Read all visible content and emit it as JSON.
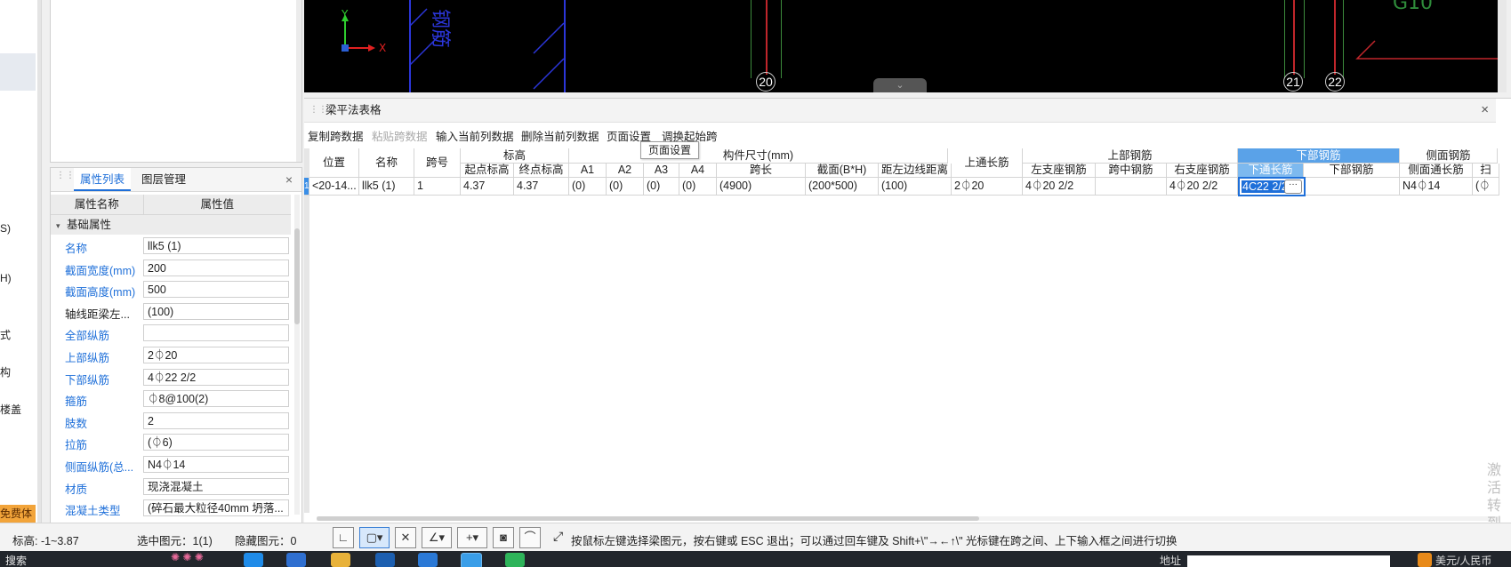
{
  "left_strip": {
    "labels": [
      {
        "text": "S)"
      },
      {
        "text": "H)"
      },
      {
        "text": "式"
      },
      {
        "text": "构"
      },
      {
        "text": "楼盖"
      }
    ],
    "trial_badge": "免费体验"
  },
  "property_panel": {
    "tabs": [
      "属性列表",
      "图层管理"
    ],
    "close": "×",
    "columns": [
      "属性名称",
      "属性值"
    ],
    "group": "基础属性",
    "rows": [
      {
        "name": "名称",
        "value": "llk5  (1)",
        "link": true
      },
      {
        "name": "截面宽度(mm)",
        "value": "200",
        "link": true
      },
      {
        "name": "截面高度(mm)",
        "value": "500",
        "link": true
      },
      {
        "name": "轴线距梁左...",
        "value": "(100)",
        "link": false
      },
      {
        "name": "全部纵筋",
        "value": "",
        "link": true
      },
      {
        "name": "上部纵筋",
        "value": "2⏀20",
        "link": true
      },
      {
        "name": "下部纵筋",
        "value": "4⏀22 2/2",
        "link": true
      },
      {
        "name": "箍筋",
        "value": "⏀8@100(2)",
        "link": true
      },
      {
        "name": "肢数",
        "value": "2",
        "link": true
      },
      {
        "name": "拉筋",
        "value": "(⏀6)",
        "link": true
      },
      {
        "name": "侧面纵筋(总...",
        "value": "N4⏀14",
        "link": true
      },
      {
        "name": "材质",
        "value": "现浇混凝土",
        "link": true
      },
      {
        "name": "混凝土类型",
        "value": "(碎石最大粒径40mm 坍落...",
        "link": true
      }
    ]
  },
  "cad": {
    "axis_x": "X",
    "axis_y": "Y",
    "axis_labels": [
      "20",
      "21",
      "22"
    ],
    "partial_text": "G10",
    "grip": "⌄"
  },
  "beam_table": {
    "title": "梁平法表格",
    "close": "×",
    "toolbar": [
      {
        "label": "复制跨数据",
        "enabled": true
      },
      {
        "label": "粘贴跨数据",
        "enabled": false
      },
      {
        "label": "输入当前列数据",
        "enabled": true
      },
      {
        "label": "删除当前列数据",
        "enabled": true
      },
      {
        "label": "页面设置",
        "enabled": true
      },
      {
        "label": "调换起始跨",
        "enabled": true
      }
    ],
    "tooltip": "页面设置",
    "headers": {
      "position": "位置",
      "name": "名称",
      "span_no": "跨号",
      "elevation": "标高",
      "start_elev": "起点标高",
      "end_elev": "终点标高",
      "dims": "构件尺寸(mm)",
      "a1": "A1",
      "a2": "A2",
      "a3": "A3",
      "a4": "A4",
      "span_len": "跨长",
      "section": "截面(B*H)",
      "left_edge": "距左边线距离",
      "top_through": "上通长筋",
      "top_rebar": "上部钢筋",
      "left_support": "左支座钢筋",
      "mid_span": "跨中钢筋",
      "right_support": "右支座钢筋",
      "bottom_rebar": "下部钢筋",
      "bottom_through": "下通长筋",
      "bottom_rebar_sub": "下部钢筋",
      "side_rebar": "侧面钢筋",
      "side_through": "侧面通长筋",
      "last_partial": "扫"
    },
    "row": {
      "row_no": "1",
      "position": "<20-14...",
      "name": "llk5  (1)",
      "span_no": "1",
      "start_elev": "4.37",
      "end_elev": "4.37",
      "a1": "(0)",
      "a2": "(0)",
      "a3": "(0)",
      "a4": "(0)",
      "span_len": "(4900)",
      "section": "(200*500)",
      "left_edge": "(100)",
      "top_through": "2⏀20",
      "left_support": "4⏀20 2/2",
      "mid_span": "",
      "right_support": "4⏀20 2/2",
      "bottom_through": "4C22 2/2",
      "bottom_rebar": "",
      "side_through": "N4⏀14",
      "last_partial": "(⏀"
    },
    "edit_button": "···"
  },
  "watermark": [
    "激活",
    "转到"
  ],
  "status": {
    "elevation": "标高:   -1~3.87",
    "selected": "选中图元：1(1)",
    "hidden": "隐藏图元：0",
    "hint": "按鼠标左键选择梁图元，按右键或 ESC 退出；可以通过回车键及 Shift+\\\"→←↑\\\" 光标键在跨之间、上下输入框之间进行切换",
    "tools": [
      {
        "icon": "corner-icon",
        "glyph": "∟"
      },
      {
        "icon": "rect-select-icon",
        "glyph": "▢▾"
      },
      {
        "icon": "cross-select-icon",
        "glyph": "✕"
      },
      {
        "icon": "angle-icon",
        "glyph": "∠▾"
      },
      {
        "icon": "insert-icon",
        "glyph": "+▾"
      },
      {
        "icon": "layer-icon",
        "glyph": "◙"
      },
      {
        "icon": "arc-icon",
        "glyph": "⌒"
      }
    ],
    "resize_glyph": "⤢"
  },
  "taskbar": {
    "search": "搜索",
    "right_label": "地址",
    "right_text": "美元/人民币"
  }
}
